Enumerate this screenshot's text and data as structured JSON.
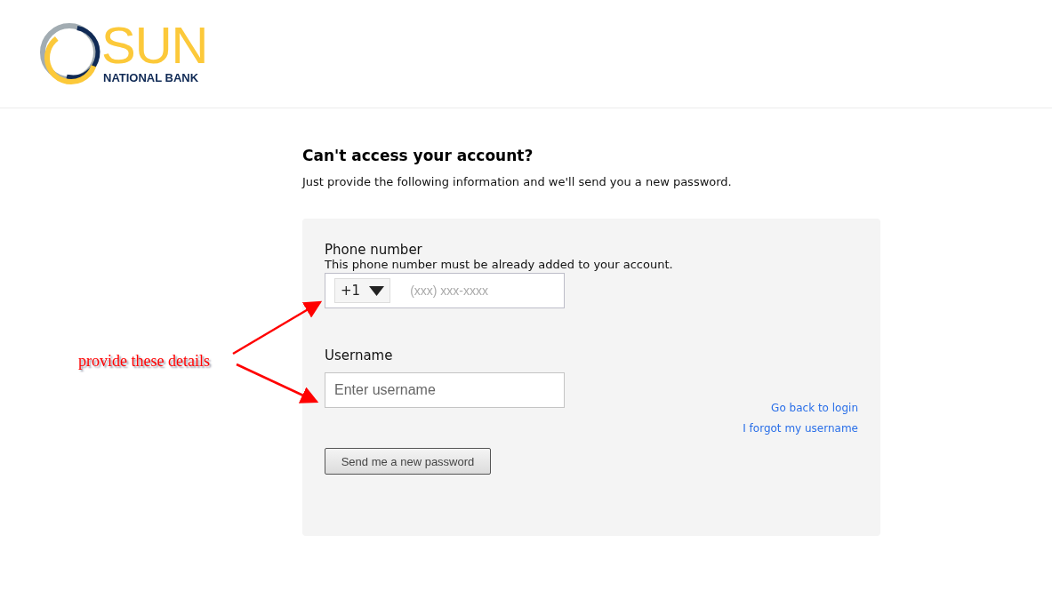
{
  "logo": {
    "name": "SUN",
    "subtitle": "NATIONAL BANK"
  },
  "heading": "Can't access your account?",
  "intro": "Just provide the following information and we'll send you a new password.",
  "phone": {
    "label": "Phone number",
    "hint": "This phone number must be already added to your account.",
    "country_code": "+1",
    "placeholder": "(xxx) xxx-xxxx"
  },
  "username": {
    "label": "Username",
    "placeholder": "Enter username"
  },
  "links": [
    "Go back to login",
    "I forgot my username"
  ],
  "submit": "Send me a new password",
  "annotation": "provide these details"
}
